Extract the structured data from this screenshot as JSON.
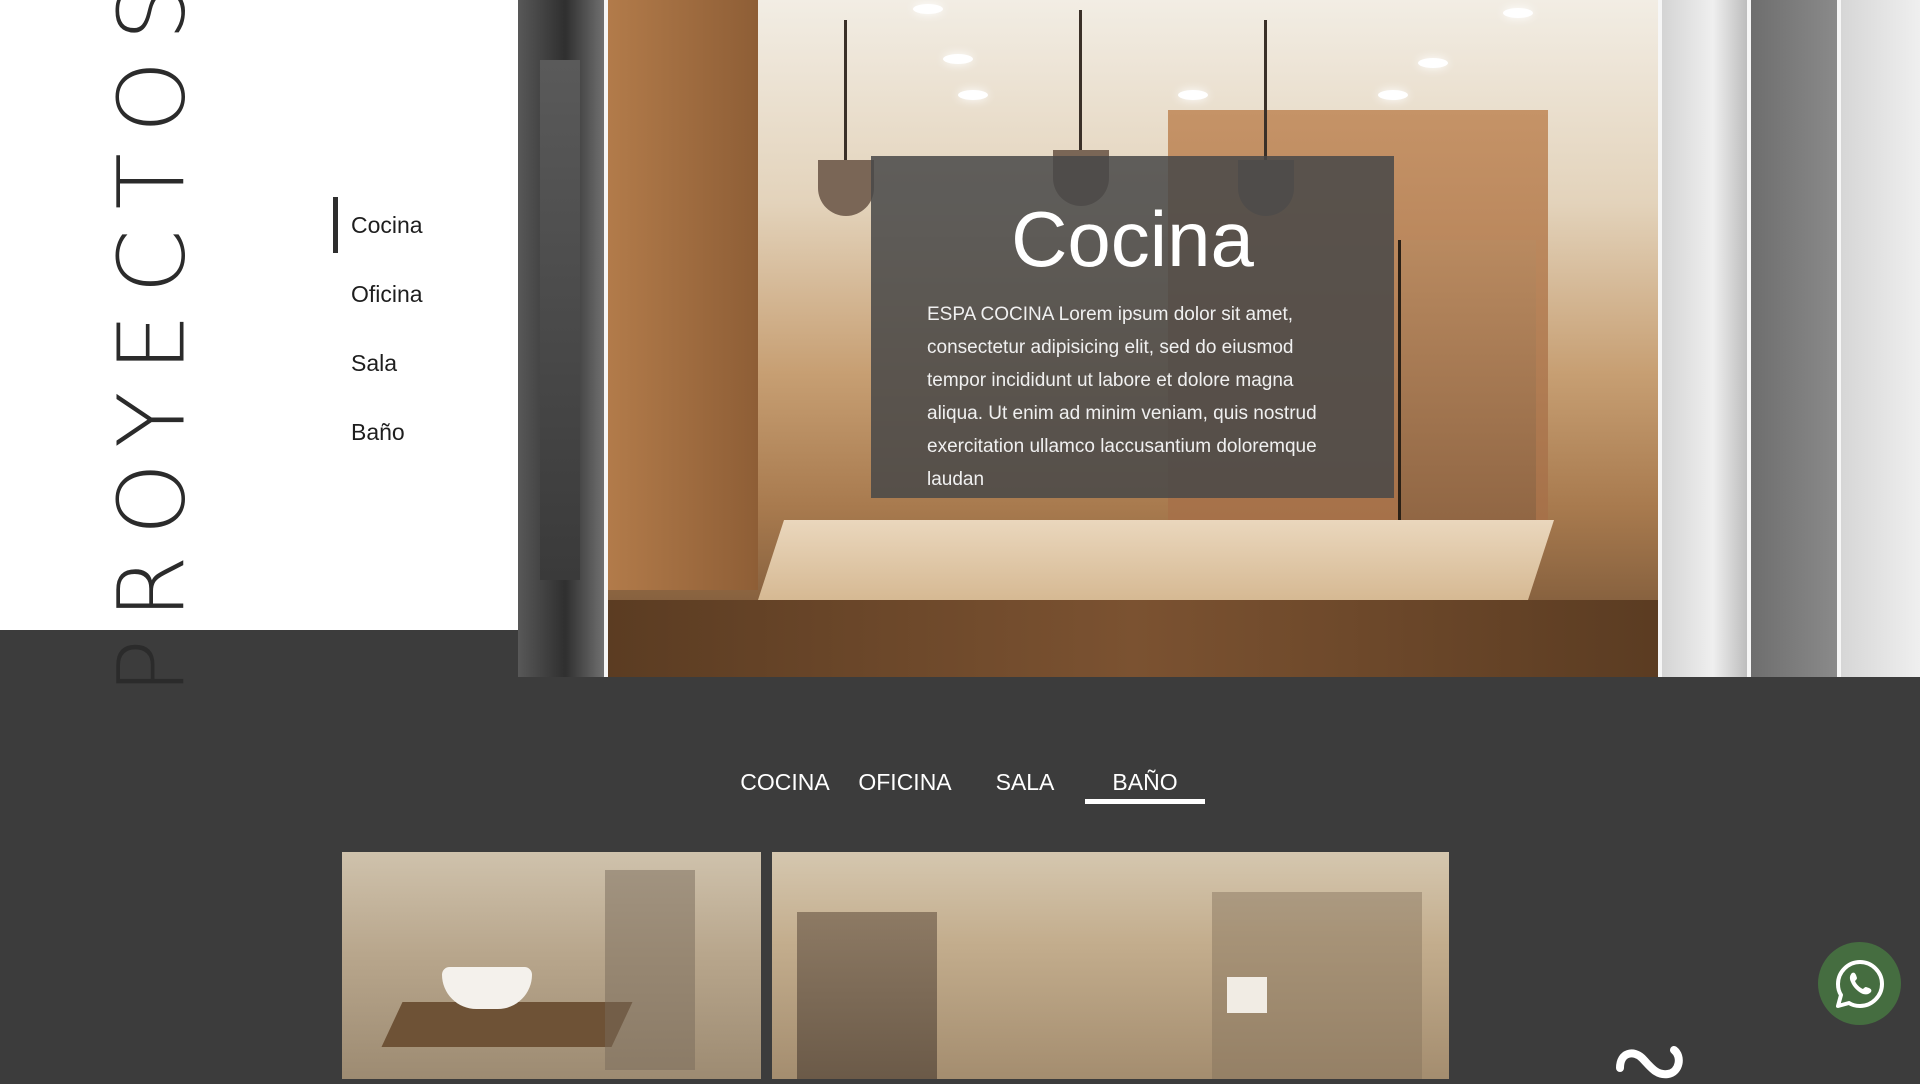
{
  "side_panel": {
    "title": "PROYECTOS",
    "nav": [
      {
        "label": "Cocina",
        "active": true
      },
      {
        "label": "Oficina",
        "active": false
      },
      {
        "label": "Sala",
        "active": false
      },
      {
        "label": "Baño",
        "active": false
      }
    ]
  },
  "hero": {
    "title": "Cocina",
    "description": "ESPA COCINA Lorem ipsum dolor sit amet, consectetur adipisicing elit, sed do eiusmod tempor incididunt ut labore et dolore magna aliqua. Ut enim ad minim veniam, quis nostrud exercitation ullamco laccusantium doloremque laudan"
  },
  "tabs": [
    {
      "label": "COCINA",
      "active": false
    },
    {
      "label": "OFICINA",
      "active": false
    },
    {
      "label": "SALA",
      "active": false
    },
    {
      "label": "BAÑO",
      "active": true
    }
  ],
  "colors": {
    "page_background": "#3c3c3c",
    "panel_background": "#ffffff",
    "overlay_background": "#484848",
    "whatsapp_button": "#456d40"
  },
  "icons": {
    "whatsapp": "whatsapp-icon",
    "brand": "brand-mark-icon"
  }
}
